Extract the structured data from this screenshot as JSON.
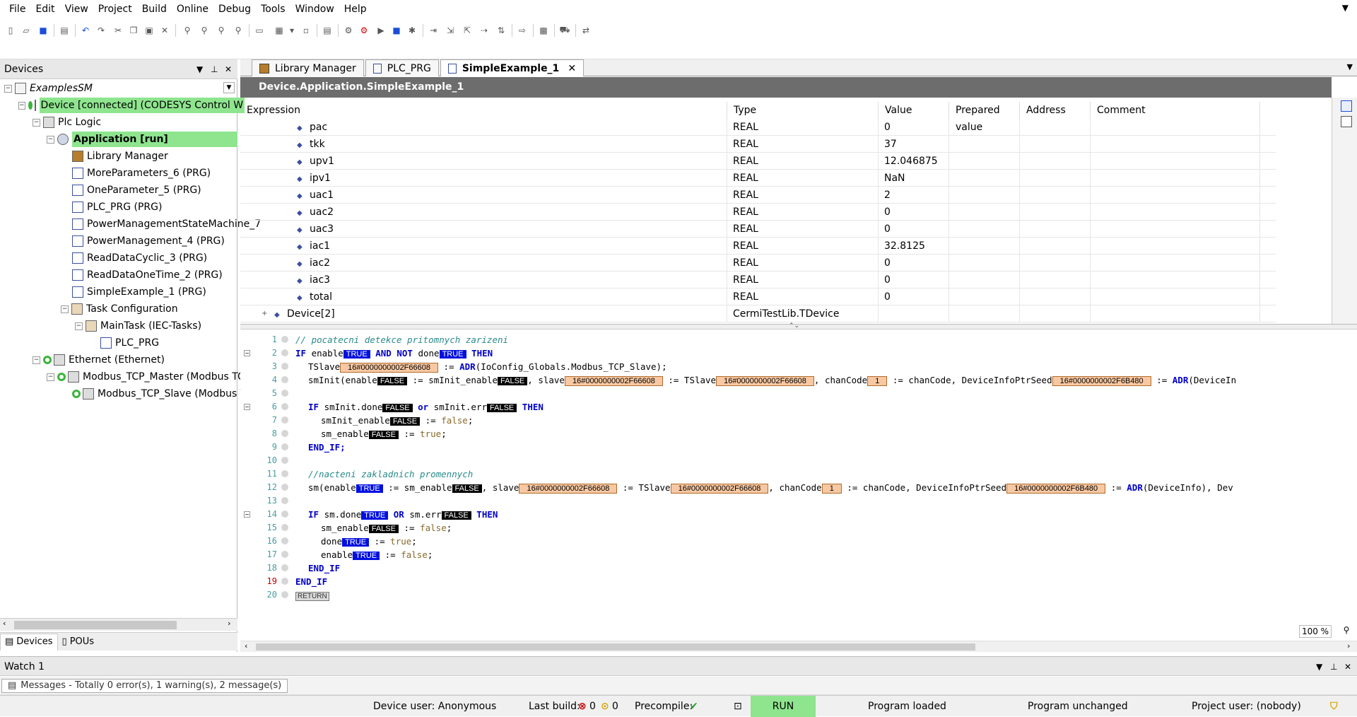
{
  "menu": [
    "File",
    "Edit",
    "View",
    "Project",
    "Build",
    "Online",
    "Debug",
    "Tools",
    "Window",
    "Help"
  ],
  "devices_panel": {
    "title": "Devices",
    "tree": [
      {
        "label": "ExamplesSM",
        "italic": true
      },
      {
        "label": "Device [connected] (CODESYS Control W"
      },
      {
        "label": "Plc Logic"
      },
      {
        "label": "Application [run]"
      },
      {
        "label": "Library Manager"
      },
      {
        "label": "MoreParameters_6 (PRG)"
      },
      {
        "label": "OneParameter_5 (PRG)"
      },
      {
        "label": "PLC_PRG (PRG)"
      },
      {
        "label": "PowerManagementStateMachine_7"
      },
      {
        "label": "PowerManagement_4 (PRG)"
      },
      {
        "label": "ReadDataCyclic_3 (PRG)"
      },
      {
        "label": "ReadDataOneTime_2 (PRG)"
      },
      {
        "label": "SimpleExample_1 (PRG)"
      },
      {
        "label": "Task Configuration"
      },
      {
        "label": "MainTask (IEC-Tasks)"
      },
      {
        "label": "PLC_PRG"
      },
      {
        "label": "Ethernet (Ethernet)"
      },
      {
        "label": "Modbus_TCP_Master (Modbus TCP"
      },
      {
        "label": "Modbus_TCP_Slave (Modbus TC"
      }
    ],
    "bottom_tabs": [
      "Devices",
      "POUs"
    ]
  },
  "editor": {
    "tabs": [
      "Library Manager",
      "PLC_PRG",
      "SimpleExample_1"
    ],
    "path": "Device.Application.SimpleExample_1",
    "columns": [
      "Expression",
      "Type",
      "Value",
      "Prepared value",
      "Address",
      "Comment"
    ],
    "rows": [
      {
        "expr": "pac",
        "type": "REAL",
        "value": "0"
      },
      {
        "expr": "tkk",
        "type": "REAL",
        "value": "37"
      },
      {
        "expr": "upv1",
        "type": "REAL",
        "value": "12.046875"
      },
      {
        "expr": "ipv1",
        "type": "REAL",
        "value": "NaN"
      },
      {
        "expr": "uac1",
        "type": "REAL",
        "value": "2"
      },
      {
        "expr": "uac2",
        "type": "REAL",
        "value": "0"
      },
      {
        "expr": "uac3",
        "type": "REAL",
        "value": "0"
      },
      {
        "expr": "iac1",
        "type": "REAL",
        "value": "32.8125"
      },
      {
        "expr": "iac2",
        "type": "REAL",
        "value": "0"
      },
      {
        "expr": "iac3",
        "type": "REAL",
        "value": "0"
      },
      {
        "expr": "total",
        "type": "REAL",
        "value": "0"
      },
      {
        "expr": "Device[2]",
        "type": "CermiTestLib.TDevice",
        "value": ""
      }
    ],
    "line_numbers": [
      "1",
      "2",
      "3",
      "4",
      "5",
      "6",
      "7",
      "8",
      "9",
      "10",
      "11",
      "12",
      "13",
      "14",
      "15",
      "16",
      "17",
      "18",
      "19",
      "20"
    ],
    "code": {
      "l1_comment": "// pocatecni detekce pritomnych zarizeni",
      "kw_if": "IF",
      "kw_and_not": "AND NOT",
      "kw_then": "THEN",
      "kw_or": "or",
      "kw_OR": "OR",
      "kw_end_if": "END_IF;",
      "kw_END_IF": "END_IF",
      "kw_adr": "ADR",
      "v_true": "TRUE",
      "v_false": "FALSE",
      "addr_a": "16#0000000002F66608",
      "addr_b": "16#0000000002F6B480",
      "num_1": "1",
      "l2_enable": " enable",
      "l2_done": " done",
      "l3_tslave": "TSlave",
      "l3_rest": "(IoConfig_Globals.Modbus_TCP_Slave);",
      "l4_sminit": "smInit(enable",
      "l4_p2": " := smInit_enable",
      "l4_p3": ", slave",
      "l4_p4": " := TSlave",
      "l4_p5": ", chanCode",
      "l4_p6": " := chanCode, DeviceInfoPtrSeed",
      "l4_p7": " := ",
      "l4_p8": "(DeviceIn",
      "l6_a": " smInit.done",
      "l6_b": " smInit.err",
      "l7_a": "smInit_enable",
      "l7_b": "false",
      "l8_a": "sm_enable",
      "l8_b": "true",
      "l11_comment": "//nacteni zakladnich promennych",
      "l12_a": "sm(enable",
      "l12_b": " := sm_enable",
      "l12_c": ", slave",
      "l12_d": " := TSlave",
      "l12_e": ", chanCode",
      "l12_f": " := chanCode, DeviceInfoPtrSeed",
      "l12_g": " := ",
      "l12_h": "(DeviceInfo), Dev",
      "l14_a": " sm.done",
      "l14_b": " sm.err",
      "l15_a": "sm_enable",
      "l15_b": "false",
      "l16_a": "done",
      "l16_b": "true",
      "l17_a": "enable",
      "l17_b": "false",
      "return": "RETURN",
      "assign": " := ",
      "semi": ";"
    },
    "zoom": "100 %"
  },
  "watch_panel": {
    "title": "Watch 1"
  },
  "messages_tab": "Messages - Totally 0 error(s), 1 warning(s), 2 message(s)",
  "status": {
    "device_user": "Device user: Anonymous",
    "last_build": "Last build:",
    "errors": "0",
    "warnings": "0",
    "precompile": "Precompile:",
    "run": "RUN",
    "program_loaded": "Program loaded",
    "program_unchanged": "Program unchanged",
    "project_user": "Project user: (nobody)"
  }
}
